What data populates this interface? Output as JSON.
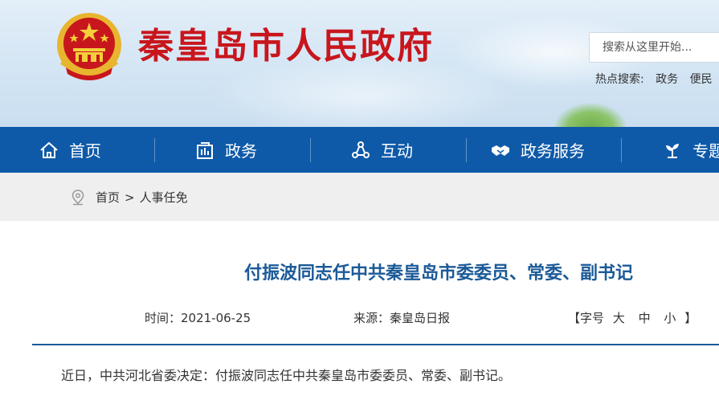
{
  "header": {
    "site_title": "秦皇岛市人民政府",
    "search": {
      "placeholder": "搜索从这里开始..."
    },
    "hot_search": {
      "label": "热点搜索:",
      "items": [
        "政务",
        "便民"
      ]
    }
  },
  "nav": {
    "items": [
      {
        "label": "首页",
        "icon": "home-icon"
      },
      {
        "label": "政务",
        "icon": "building-icon"
      },
      {
        "label": "互动",
        "icon": "network-icon"
      },
      {
        "label": "政务服务",
        "icon": "handshake-icon"
      },
      {
        "label": "专题",
        "icon": "plant-icon"
      }
    ]
  },
  "breadcrumb": {
    "home": "首页",
    "separator": ">",
    "current": "人事任免"
  },
  "article": {
    "title": "付振波同志任中共秦皇岛市委委员、常委、副书记",
    "time": "时间：2021-06-25",
    "source": "来源：秦皇岛日报",
    "font_size": {
      "open": "【字号",
      "large": "大",
      "medium": "中",
      "small": "小",
      "close": "】"
    },
    "body": "近日，中共河北省委决定：付振波同志任中共秦皇岛市委委员、常委、副书记。"
  },
  "colors": {
    "brand_red": "#c8161d",
    "nav_blue": "#0f5aa8",
    "title_blue": "#1b5a97"
  }
}
